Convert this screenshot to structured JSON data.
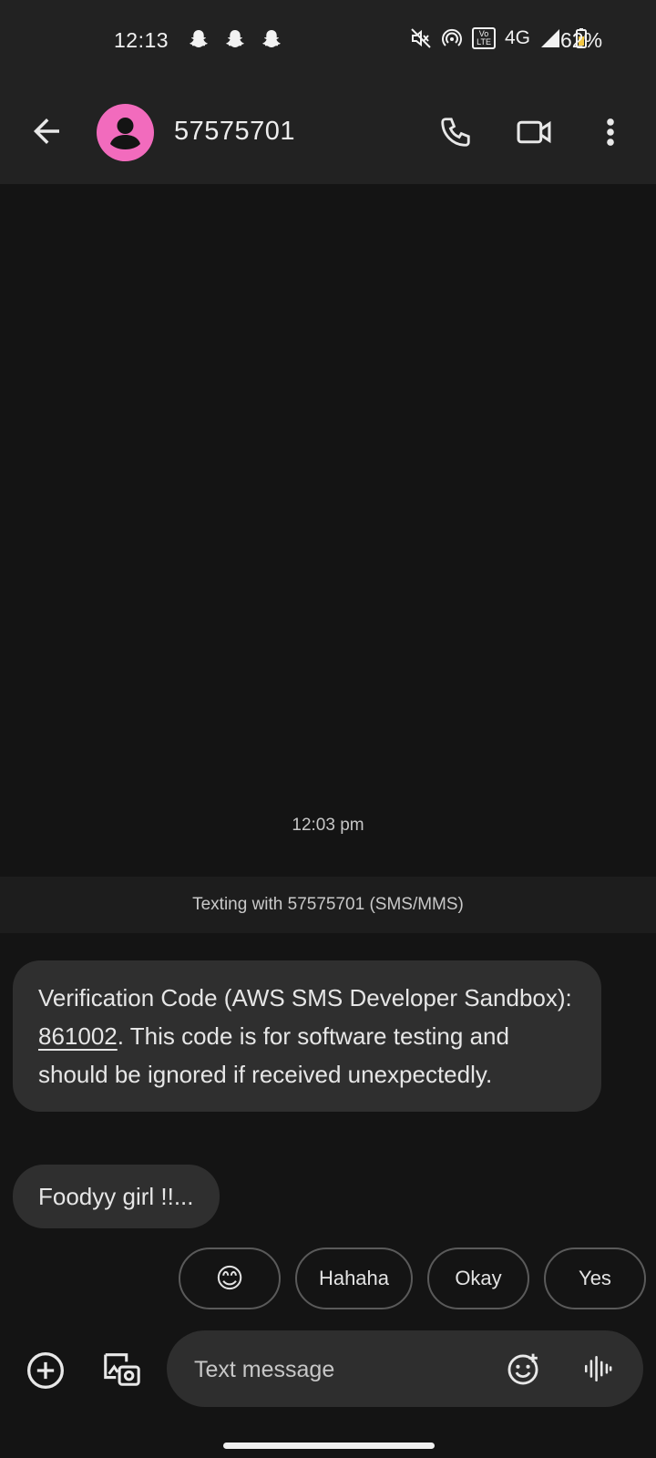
{
  "status_bar": {
    "time": "12:13",
    "notification_icons": [
      "snapchat-icon",
      "snapchat-icon",
      "snapchat-icon"
    ],
    "status_icons": [
      "mute-icon",
      "hotspot-icon",
      "volte-icon",
      "signal-icon",
      "battery-icon"
    ],
    "volte_label": "Vo\nLTE",
    "network": "4G",
    "battery": "62%"
  },
  "app_bar": {
    "contact": "57575701",
    "avatar_color": "#f26bbd"
  },
  "conversation": {
    "timestamp": "12:03 pm",
    "banner": "Texting with 57575701 (SMS/MMS)",
    "messages": [
      {
        "before_code": "Verification Code (AWS SMS Developer Sandbox): ",
        "code": "861002",
        "after_code": ". This code is for software testing and should be ignored if received unexpectedly."
      },
      {
        "text": "Foodyy girl !!..."
      }
    ]
  },
  "smart_replies": [
    "😊",
    "Hahaha",
    "Okay",
    "Yes"
  ],
  "compose": {
    "placeholder": "Text message"
  },
  "colors": {
    "background": "#141414",
    "bar": "#222222",
    "bubble": "#2f2f2f",
    "accent_avatar": "#f26bbd"
  }
}
